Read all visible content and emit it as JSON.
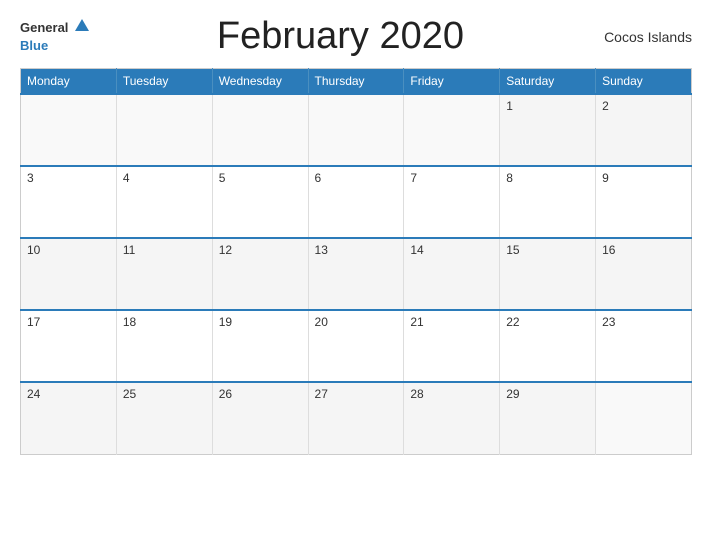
{
  "header": {
    "logo_general": "General",
    "logo_blue": "Blue",
    "title": "February 2020",
    "region": "Cocos Islands"
  },
  "calendar": {
    "weekdays": [
      "Monday",
      "Tuesday",
      "Wednesday",
      "Thursday",
      "Friday",
      "Saturday",
      "Sunday"
    ],
    "weeks": [
      [
        {
          "day": "",
          "empty": true
        },
        {
          "day": "",
          "empty": true
        },
        {
          "day": "",
          "empty": true
        },
        {
          "day": "",
          "empty": true
        },
        {
          "day": "",
          "empty": true
        },
        {
          "day": "1",
          "empty": false
        },
        {
          "day": "2",
          "empty": false
        }
      ],
      [
        {
          "day": "3",
          "empty": false
        },
        {
          "day": "4",
          "empty": false
        },
        {
          "day": "5",
          "empty": false
        },
        {
          "day": "6",
          "empty": false
        },
        {
          "day": "7",
          "empty": false
        },
        {
          "day": "8",
          "empty": false
        },
        {
          "day": "9",
          "empty": false
        }
      ],
      [
        {
          "day": "10",
          "empty": false
        },
        {
          "day": "11",
          "empty": false
        },
        {
          "day": "12",
          "empty": false
        },
        {
          "day": "13",
          "empty": false
        },
        {
          "day": "14",
          "empty": false
        },
        {
          "day": "15",
          "empty": false
        },
        {
          "day": "16",
          "empty": false
        }
      ],
      [
        {
          "day": "17",
          "empty": false
        },
        {
          "day": "18",
          "empty": false
        },
        {
          "day": "19",
          "empty": false
        },
        {
          "day": "20",
          "empty": false
        },
        {
          "day": "21",
          "empty": false
        },
        {
          "day": "22",
          "empty": false
        },
        {
          "day": "23",
          "empty": false
        }
      ],
      [
        {
          "day": "24",
          "empty": false
        },
        {
          "day": "25",
          "empty": false
        },
        {
          "day": "26",
          "empty": false
        },
        {
          "day": "27",
          "empty": false
        },
        {
          "day": "28",
          "empty": false
        },
        {
          "day": "29",
          "empty": false
        },
        {
          "day": "",
          "empty": true
        }
      ]
    ]
  }
}
